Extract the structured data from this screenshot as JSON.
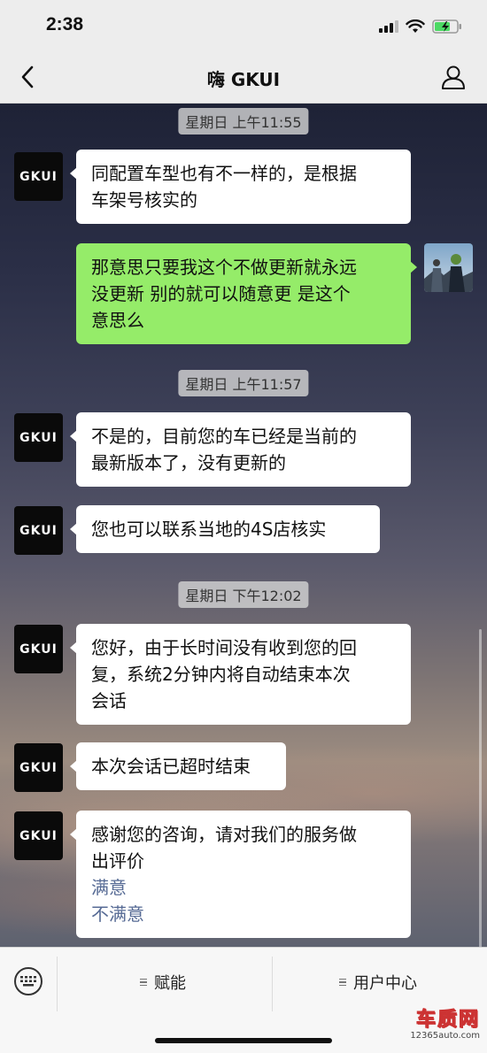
{
  "status_bar": {
    "time": "2:38"
  },
  "header": {
    "title": "嗨 GKUI"
  },
  "chat": {
    "timestamps": [
      "星期日 上午11:55",
      "星期日 上午11:57",
      "星期日 下午12:02"
    ],
    "bot_avatar_text": "GKUI",
    "messages": [
      {
        "from": "bot",
        "lines": [
          "同配置车型也有不一样的，是根据",
          "车架号核实的"
        ]
      },
      {
        "from": "user",
        "lines": [
          "那意思只要我这个不做更新就永远",
          "没更新 别的就可以随意更 是这个",
          "意思么"
        ]
      },
      {
        "from": "bot",
        "lines": [
          "不是的，目前您的车已经是当前的",
          "最新版本了，没有更新的"
        ]
      },
      {
        "from": "bot",
        "lines": [
          "您也可以联系当地的4S店核实"
        ]
      },
      {
        "from": "bot",
        "lines": [
          "您好，由于长时间没有收到您的回",
          "复，系统2分钟内将自动结束本次",
          "会话"
        ]
      },
      {
        "from": "bot",
        "lines": [
          "本次会话已超时结束"
        ]
      },
      {
        "from": "bot",
        "lines": [
          "感谢您的咨询，请对我们的服务做",
          "出评价"
        ],
        "links": [
          "满意",
          "不满意"
        ]
      }
    ]
  },
  "bottom_menu": {
    "items": [
      "赋能",
      "用户中心"
    ]
  },
  "watermark": {
    "brand": "车质网",
    "url": "12365auto.com"
  },
  "colors": {
    "user_bubble": "#95ec69",
    "bot_bubble": "#ffffff",
    "link": "#576b95"
  }
}
